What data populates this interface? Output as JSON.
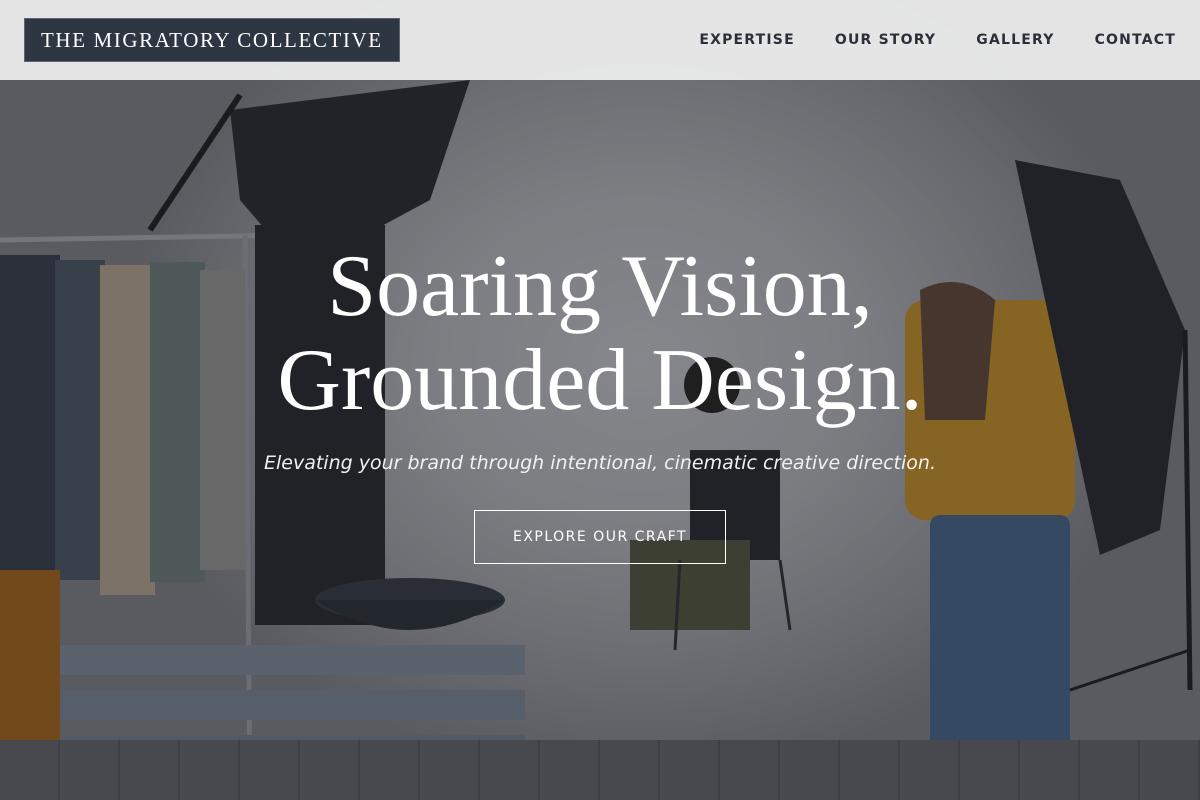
{
  "brand": {
    "logo_text": "THE MIGRATORY COLLECTIVE"
  },
  "nav": {
    "items": [
      {
        "label": "EXPERTISE"
      },
      {
        "label": "OUR STORY"
      },
      {
        "label": "GALLERY"
      },
      {
        "label": "CONTACT"
      }
    ]
  },
  "hero": {
    "headline_line1": "Soaring Vision,",
    "headline_line2": "Grounded Design.",
    "subheadline": "Elevating your brand through intentional, cinematic creative direction.",
    "cta_label": "EXPLORE OUR CRAFT",
    "image_description_icon": "photo-studio-image"
  },
  "colors": {
    "header_bg": "#ececec",
    "logo_bg": "#2e3644",
    "nav_text": "#2a2f38",
    "hero_text": "#ffffff"
  }
}
